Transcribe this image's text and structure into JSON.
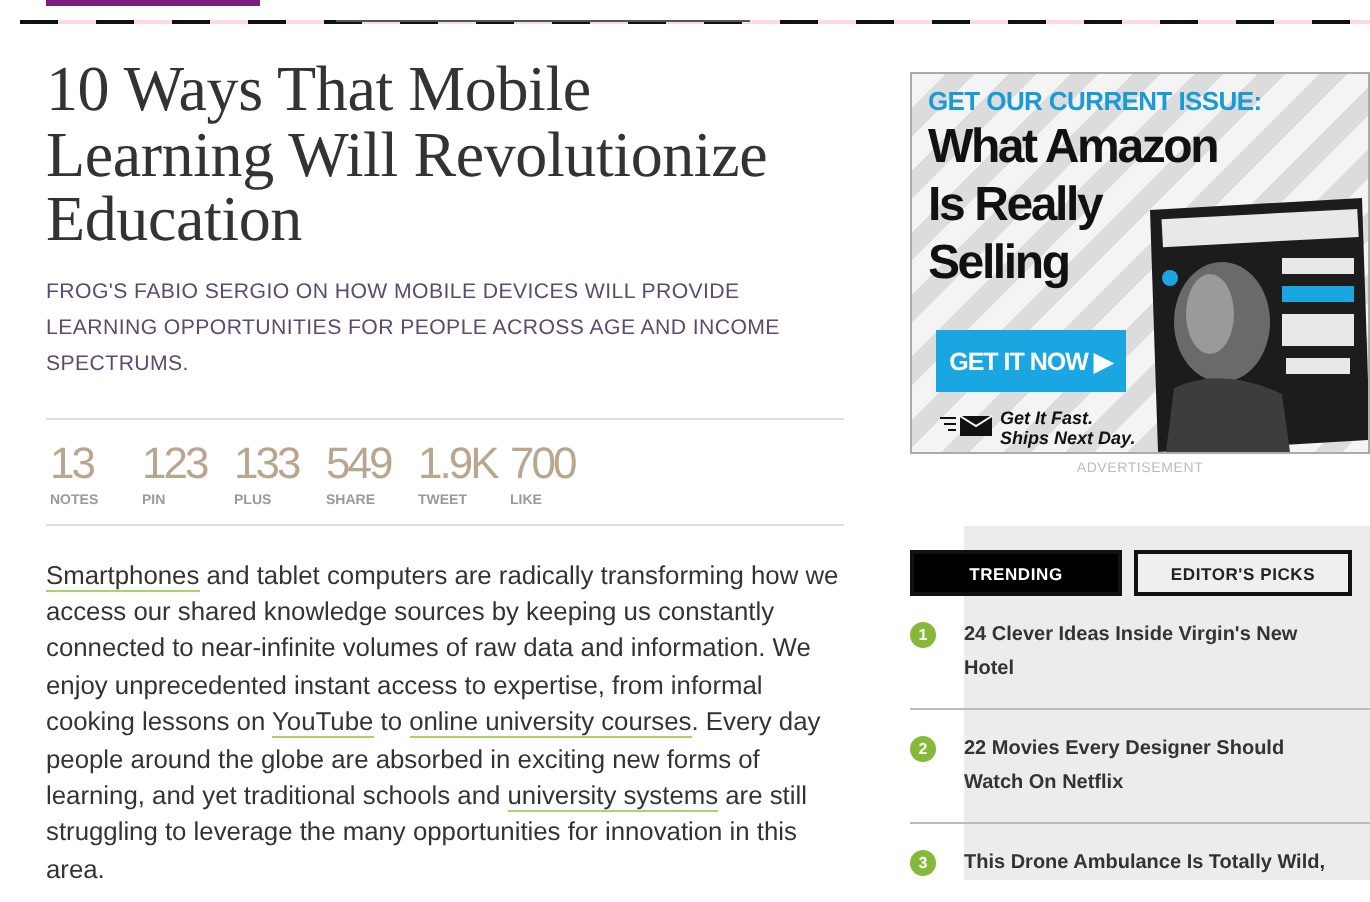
{
  "article": {
    "title": "10 Ways That Mobile Learning Will Revolutionize Education",
    "subtitle": "FROG'S FABIO SERGIO ON HOW MOBILE DEVICES WILL PROVIDE LEARNING OPPORTUNITIES FOR PEOPLE ACROSS AGE AND INCOME SPECTRUMS.",
    "stats": [
      {
        "value": "13",
        "label": "NOTES"
      },
      {
        "value": "123",
        "label": "PIN"
      },
      {
        "value": "133",
        "label": "PLUS"
      },
      {
        "value": "549",
        "label": "SHARE"
      },
      {
        "value": "1.9K",
        "label": "TWEET"
      },
      {
        "value": "700",
        "label": "LIKE"
      }
    ],
    "body": [
      {
        "text": "Smartphones",
        "link": true
      },
      {
        "text": " and tablet computers are radically transforming how we access our shared knowledge sources by keeping us constantly connected to near-infinite volumes of raw data and information. We enjoy unprecedented instant access to expertise, from informal cooking lessons on ",
        "link": false
      },
      {
        "text": "YouTube",
        "link": true
      },
      {
        "text": " to ",
        "link": false
      },
      {
        "text": "online university courses",
        "link": true
      },
      {
        "text": ". Every day people around the globe are absorbed in exciting new forms of learning, and yet traditional schools and ",
        "link": false
      },
      {
        "text": "university systems",
        "link": true
      },
      {
        "text": " are still struggling to leverage the many opportunities for innovation in this area.",
        "link": false
      }
    ]
  },
  "sidebar": {
    "ad": {
      "kicker": "GET OUR CURRENT ISSUE:",
      "headline": "What Amazon Is Really Selling",
      "button": "GET IT NOW ▶",
      "shipping": "Get It Fast. Ships Next Day."
    },
    "ad_label": "ADVERTISEMENT",
    "tabs": [
      {
        "label": "TRENDING",
        "selected": true
      },
      {
        "label": "EDITOR'S PICKS",
        "selected": false
      }
    ],
    "trending": [
      {
        "number": "1",
        "title": "24 Clever Ideas Inside Virgin's New Hotel"
      },
      {
        "number": "2",
        "title": "22 Movies Every Designer Should Watch On Netflix"
      },
      {
        "number": "3",
        "title": "This Drone Ambulance Is Totally Wild,"
      }
    ]
  }
}
